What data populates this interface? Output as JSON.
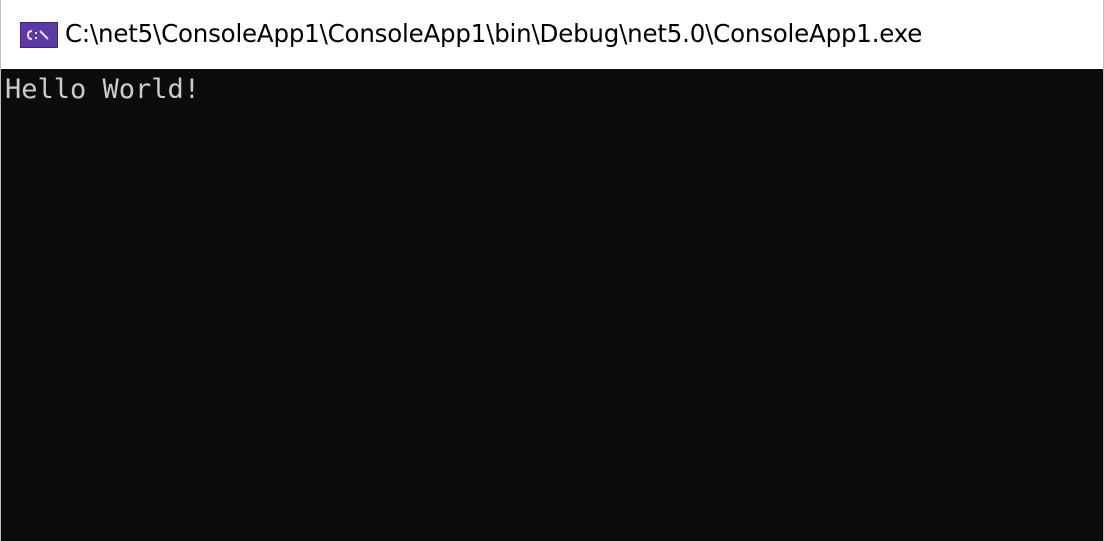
{
  "window": {
    "title": "C:\\net5\\ConsoleApp1\\ConsoleApp1\\bin\\Debug\\net5.0\\ConsoleApp1.exe",
    "icon": "console-app-icon"
  },
  "console": {
    "lines": [
      "Hello World!"
    ],
    "background_color": "#0c0c0c",
    "text_color": "#cccccc"
  },
  "colors": {
    "icon_accent": "#5b3aa8"
  }
}
